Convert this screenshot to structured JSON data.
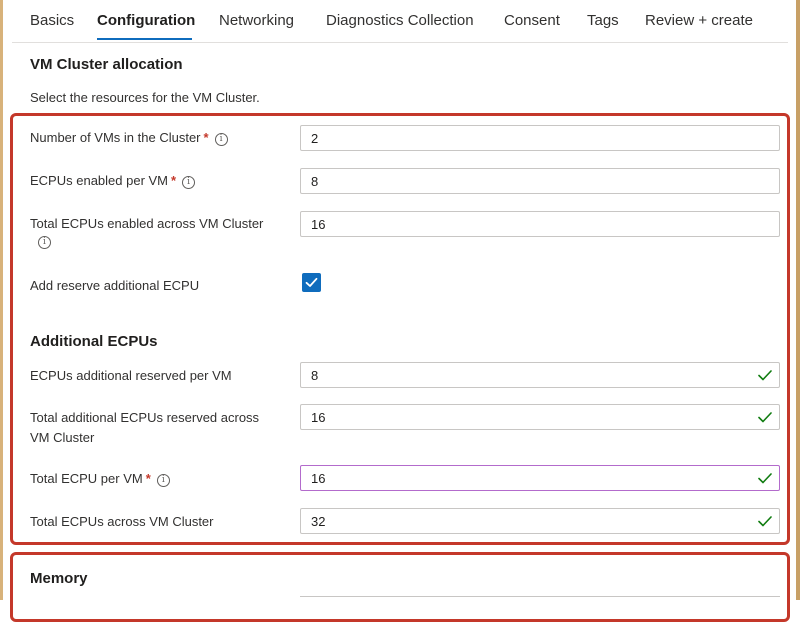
{
  "tabs": [
    {
      "label": "Basics",
      "active": false
    },
    {
      "label": "Configuration",
      "active": true
    },
    {
      "label": "Networking",
      "active": false
    },
    {
      "label": "Diagnostics Collection",
      "active": false
    },
    {
      "label": "Consent",
      "active": false
    },
    {
      "label": "Tags",
      "active": false
    },
    {
      "label": "Review + create",
      "active": false
    }
  ],
  "allocation": {
    "title": "VM Cluster allocation",
    "description": "Select the resources for the VM Cluster."
  },
  "fields": {
    "num_vms": {
      "label": "Number of VMs in the Cluster",
      "required": true,
      "value": "2"
    },
    "ecpus_per_vm": {
      "label": "ECPUs enabled per VM",
      "required": true,
      "value": "8"
    },
    "total_ecpus": {
      "label": "Total ECPUs enabled across VM Cluster",
      "value": "16"
    },
    "add_reserve": {
      "label": "Add reserve additional ECPU",
      "checked": true
    }
  },
  "additional": {
    "title": "Additional ECPUs",
    "reserved_per_vm": {
      "label": "ECPUs additional reserved per VM",
      "value": "8",
      "valid": true
    },
    "total_reserved": {
      "label_line1": "Total additional ECPUs reserved across",
      "label_line2": "VM Cluster",
      "value": "16",
      "valid": true
    },
    "total_per_vm": {
      "label": "Total ECPU per VM",
      "required": true,
      "value": "16",
      "valid": true,
      "focused": true
    },
    "total_across": {
      "label": "Total ECPUs across VM Cluster",
      "value": "32",
      "valid": true
    }
  },
  "memory": {
    "title": "Memory"
  },
  "colors": {
    "accent": "#0f6cbd",
    "highlight": "#c4382a",
    "valid": "#107c10",
    "focus": "#b36bcc"
  }
}
